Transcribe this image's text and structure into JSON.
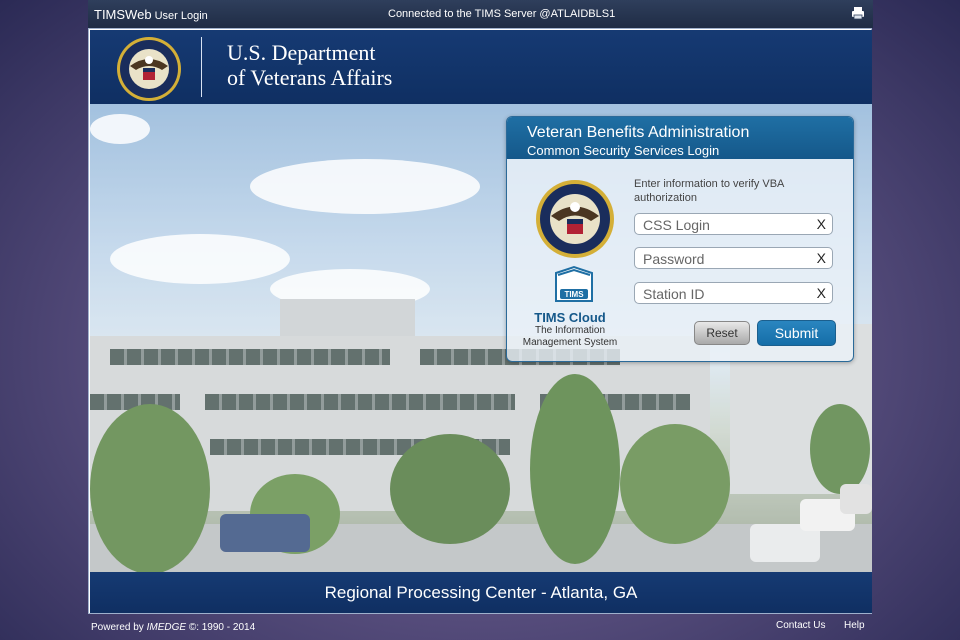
{
  "topbar": {
    "app_name": "TIMSWeb",
    "app_subtitle": "User Login",
    "connection": "Connected to the TIMS Server @ATLAIDBLS1",
    "printer_icon": "printer-icon"
  },
  "header": {
    "line1": "U.S. Department",
    "line2": "of Veterans Affairs"
  },
  "login": {
    "title": "Veteran Benefits Administration",
    "subtitle": "Common Security Services Login",
    "instructions": "Enter information to verify VBA authorization",
    "fields": [
      {
        "placeholder": "CSS Login",
        "value": "",
        "clear": "X"
      },
      {
        "placeholder": "Password",
        "value": "",
        "clear": "X"
      },
      {
        "placeholder": "Station ID",
        "value": "",
        "clear": "X"
      }
    ],
    "product_name": "TIMS Cloud",
    "product_desc_1": "The Information",
    "product_desc_2": "Management System",
    "logo_text": "TIMS",
    "reset_label": "Reset",
    "submit_label": "Submit"
  },
  "footer_band": "Regional Processing Center - Atlanta, GA",
  "bottombar": {
    "powered_prefix": "Powered by ",
    "powered_brand": "IMEDGE",
    "powered_suffix": " ©: 1990 - 2014",
    "contact": "Contact Us",
    "help": "Help"
  },
  "colors": {
    "header_navy": "#163a73",
    "login_blue": "#1f6fa4",
    "submit_blue": "#2a86c0"
  }
}
